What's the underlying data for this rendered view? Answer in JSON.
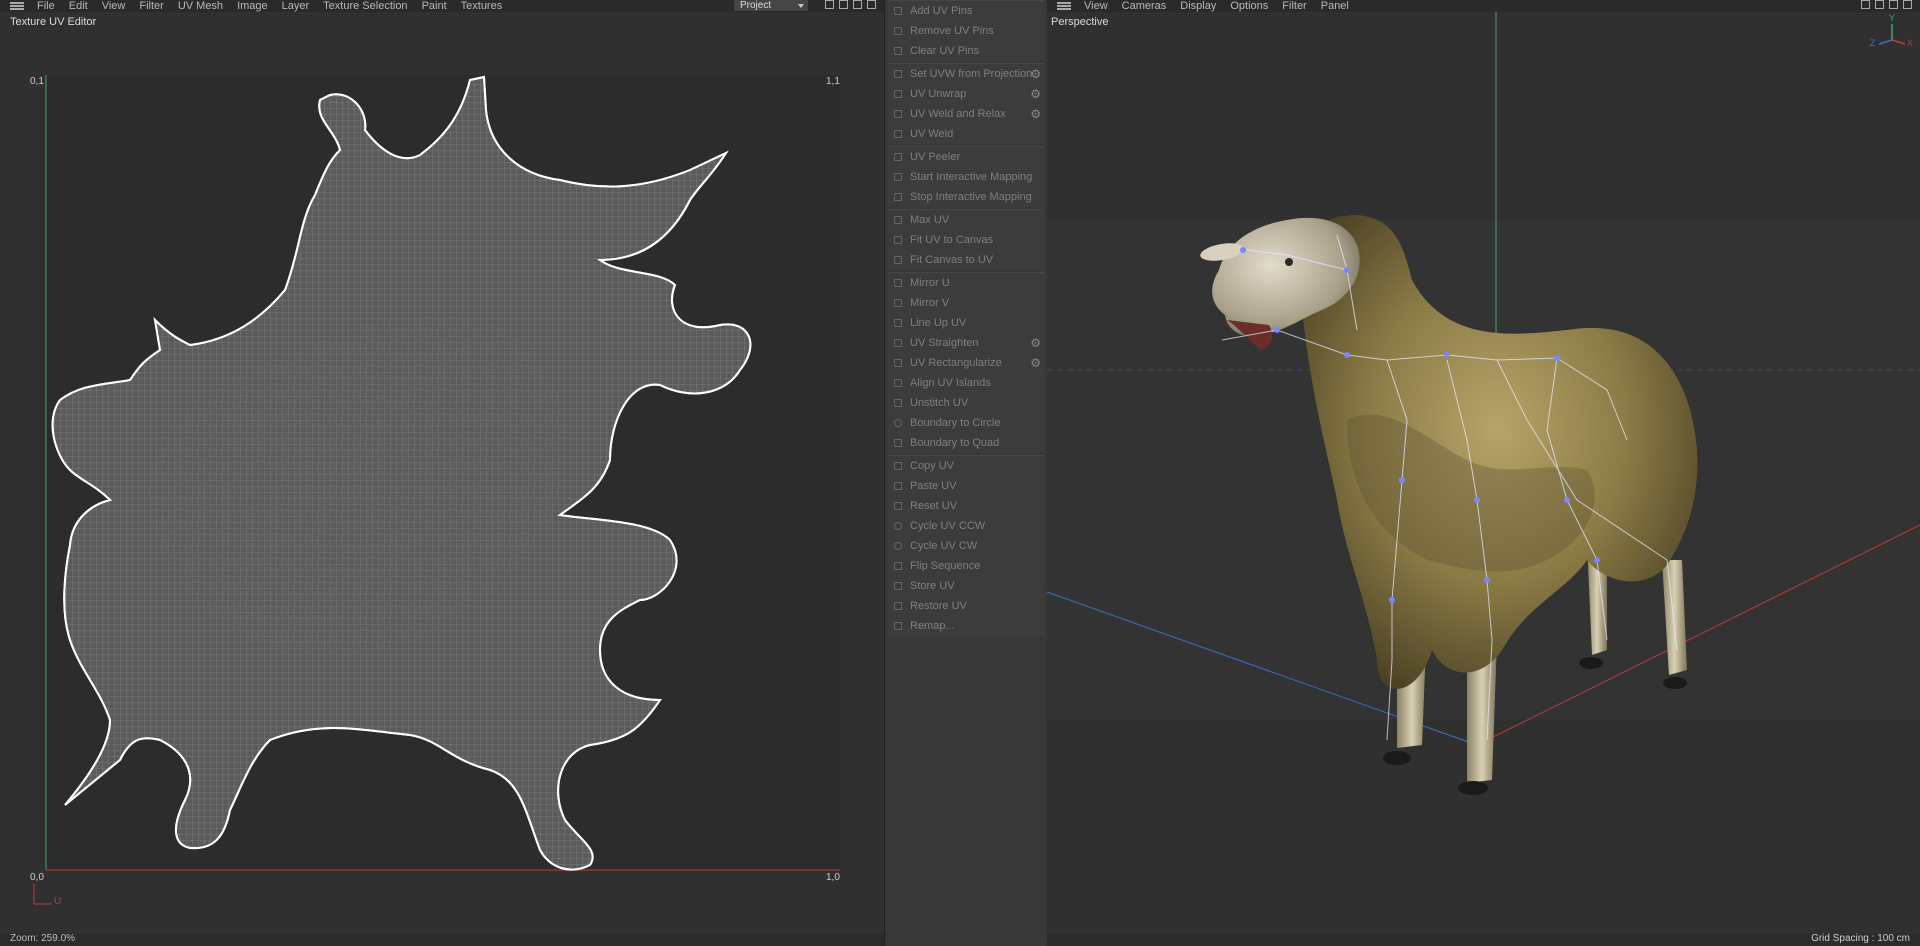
{
  "uv_editor": {
    "menu": [
      "File",
      "Edit",
      "View",
      "Filter",
      "UV Mesh",
      "Image",
      "Layer",
      "Texture Selection",
      "Paint",
      "Textures"
    ],
    "project_select": "Project",
    "title": "Texture UV Editor",
    "corner_tl": "0,1",
    "corner_tr": "1,1",
    "corner_bl": "0,0",
    "corner_br": "1,0",
    "axis_u": "U",
    "zoom": "Zoom: 259.0%"
  },
  "commands": {
    "groups": [
      [
        "Add UV Pins",
        "Remove UV Pins",
        "Clear UV Pins"
      ],
      [
        "Set UVW from Projection",
        "UV Unwrap",
        "UV Weld and Relax",
        "UV Weld"
      ],
      [
        "UV Peeler",
        "Start Interactive Mapping",
        "Stop Interactive Mapping"
      ],
      [
        "Max UV",
        "Fit UV to Canvas",
        "Fit Canvas to UV"
      ],
      [
        "Mirror U",
        "Mirror V",
        "Line Up UV",
        "UV Straighten",
        "UV Rectangularize",
        "Align UV Islands",
        "Unstitch UV",
        "Boundary to Circle",
        "Boundary to Quad"
      ],
      [
        "Copy UV",
        "Paste UV",
        "Reset UV",
        "Cycle UV CCW",
        "Cycle UV CW",
        "Flip Sequence",
        "Store UV",
        "Restore UV",
        "Remap..."
      ]
    ]
  },
  "viewport": {
    "menu": [
      "View",
      "Cameras",
      "Display",
      "Options",
      "Filter",
      "Panel"
    ],
    "title": "Perspective",
    "grid_spacing": "Grid Spacing : 100 cm",
    "axis_x": "X",
    "axis_y": "Y",
    "axis_z": "Z"
  },
  "colors": {
    "axis_green": "#3fa86a",
    "axis_red": "#c0393c",
    "axis_blue": "#3b6fc4",
    "wool": "#9a8a55"
  }
}
